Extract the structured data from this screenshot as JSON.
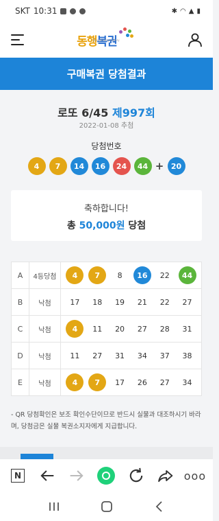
{
  "statusbar": {
    "carrier": "SKT",
    "time": "10:31"
  },
  "header": {
    "logo_part1": "동행",
    "logo_part2": "복권",
    "logo_sub": "Donghaeng Lottery"
  },
  "page_title": "구매복권 당첨결과",
  "draw": {
    "game": "로또 6/45",
    "round": "제997회",
    "date": "2022-01-08 추첨",
    "winning_label": "당첨번호",
    "winning_numbers": [
      {
        "n": "4",
        "color": "#e3a715"
      },
      {
        "n": "7",
        "color": "#e3a715"
      },
      {
        "n": "14",
        "color": "#2189d8"
      },
      {
        "n": "16",
        "color": "#2189d8"
      },
      {
        "n": "24",
        "color": "#e4544e"
      },
      {
        "n": "44",
        "color": "#5bb53b"
      }
    ],
    "plus": "+",
    "bonus": {
      "n": "20",
      "color": "#2189d8"
    }
  },
  "prize": {
    "message": "축하합니다!",
    "prefix": "총",
    "amount": "50,000원",
    "suffix": "당첨"
  },
  "tickets": [
    {
      "label": "A",
      "result": "4등당첨",
      "numbers": [
        {
          "n": "4",
          "hit": true,
          "color": "#e3a715"
        },
        {
          "n": "7",
          "hit": true,
          "color": "#e3a715"
        },
        {
          "n": "8",
          "hit": false
        },
        {
          "n": "16",
          "hit": true,
          "color": "#2189d8"
        },
        {
          "n": "22",
          "hit": false
        },
        {
          "n": "44",
          "hit": true,
          "color": "#5bb53b"
        }
      ]
    },
    {
      "label": "B",
      "result": "낙첨",
      "numbers": [
        {
          "n": "17",
          "hit": false
        },
        {
          "n": "18",
          "hit": false
        },
        {
          "n": "19",
          "hit": false
        },
        {
          "n": "21",
          "hit": false
        },
        {
          "n": "22",
          "hit": false
        },
        {
          "n": "27",
          "hit": false
        }
      ]
    },
    {
      "label": "C",
      "result": "낙첨",
      "numbers": [
        {
          "n": "4",
          "hit": true,
          "color": "#e3a715"
        },
        {
          "n": "11",
          "hit": false
        },
        {
          "n": "20",
          "hit": false
        },
        {
          "n": "27",
          "hit": false
        },
        {
          "n": "28",
          "hit": false
        },
        {
          "n": "31",
          "hit": false
        }
      ]
    },
    {
      "label": "D",
      "result": "낙첨",
      "numbers": [
        {
          "n": "11",
          "hit": false
        },
        {
          "n": "27",
          "hit": false
        },
        {
          "n": "31",
          "hit": false
        },
        {
          "n": "34",
          "hit": false
        },
        {
          "n": "37",
          "hit": false
        },
        {
          "n": "38",
          "hit": false
        }
      ]
    },
    {
      "label": "E",
      "result": "낙첨",
      "numbers": [
        {
          "n": "4",
          "hit": true,
          "color": "#e3a715"
        },
        {
          "n": "7",
          "hit": true,
          "color": "#e3a715"
        },
        {
          "n": "17",
          "hit": false
        },
        {
          "n": "26",
          "hit": false
        },
        {
          "n": "27",
          "hit": false
        },
        {
          "n": "34",
          "hit": false
        }
      ]
    }
  ],
  "notice": "- QR 당첨확인은 보조 확인수단이므로 반드시 실물과 대조하시기 바라며, 당첨금은 실물 복권소지자에게 지급합니다.",
  "browser": {
    "n_label": "N",
    "more": "ooo"
  }
}
